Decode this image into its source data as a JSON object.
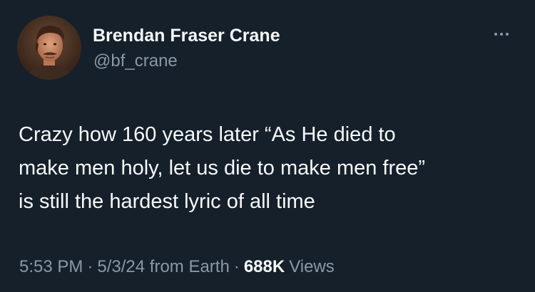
{
  "author": {
    "display_name": "Brendan Fraser Crane",
    "handle": "@bf_crane",
    "avatar_icon": "profile-photo"
  },
  "more_icon": "more-horizontal-icon",
  "tweet": {
    "lines": [
      "Crazy how 160 years later “As He died to",
      "make men holy, let us die to make men free”",
      "is still the hardest lyric of all time"
    ]
  },
  "meta": {
    "time": "5:53 PM",
    "separator": "·",
    "date_source": "5/3/24 from Earth",
    "views_count": "688K",
    "views_label": "Views"
  },
  "colors": {
    "background": "#15202b",
    "primary_text": "#f7f9f9",
    "secondary_text": "#8b98a5"
  }
}
